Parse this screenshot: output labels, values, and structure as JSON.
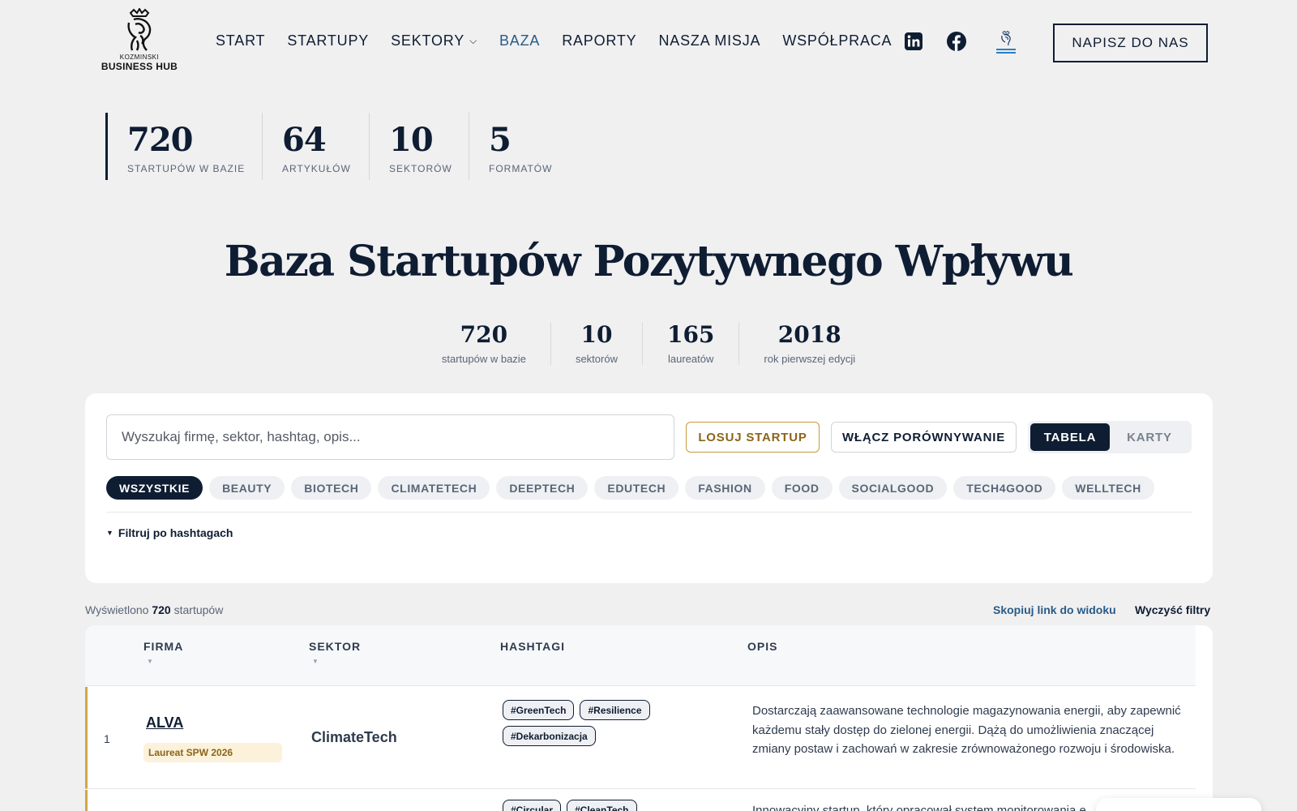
{
  "logo": {
    "small": "KOZMINSKI",
    "big": "BUSINESS HUB"
  },
  "nav": [
    {
      "label": "START"
    },
    {
      "label": "STARTUPY"
    },
    {
      "label": "SEKTORY"
    },
    {
      "label": "BAZA"
    },
    {
      "label": "RAPORTY"
    },
    {
      "label": "NASZA MISJA"
    },
    {
      "label": "WSPÓŁPRACA"
    }
  ],
  "social": {
    "linkedin": "linkedin-icon",
    "facebook": "facebook-icon",
    "kbh": "kozminski-business-hub-icon"
  },
  "cta_label": "NAPISZ DO NAS",
  "top_stats": [
    {
      "num": "720",
      "label": "STARTUPÓW W BAZIE"
    },
    {
      "num": "64",
      "label": "ARTYKUŁÓW"
    },
    {
      "num": "10",
      "label": "SEKTORÓW"
    },
    {
      "num": "5",
      "label": "FORMATÓW"
    }
  ],
  "title": "Baza Startupów Pozytywnego Wpływu",
  "mid_stats": [
    {
      "num": "720",
      "label": "startupów w bazie"
    },
    {
      "num": "10",
      "label": "sektorów"
    },
    {
      "num": "165",
      "label": "laureatów"
    },
    {
      "num": "2018",
      "label": "rok pierwszej edycji"
    }
  ],
  "search": {
    "placeholder": "Wyszukaj firmę, sektor, hashtag, opis..."
  },
  "buttons": {
    "losuj": "LOSUJ STARTUP",
    "porownywanie": "WŁĄCZ PORÓWNYWANIE"
  },
  "view_toggle": {
    "table": "TABELA",
    "cards": "KARTY",
    "selected": "TABELA"
  },
  "chips": [
    "WSZYSTKIE",
    "BEAUTY",
    "BIOTECH",
    "CLIMATETECH",
    "DEEPTECH",
    "EDUTECH",
    "FASHION",
    "FOOD",
    "SOCIALGOOD",
    "TECH4GOOD",
    "WELLTECH"
  ],
  "hashtag_filter": "Filtruj po hashtagach",
  "results": {
    "prefix": "Wyświetlono",
    "count": "720",
    "suffix": "startupów",
    "copy_link": "Skopiuj link do widoku",
    "clear": "Wyczyść filtry"
  },
  "table": {
    "headers": [
      "FIRMA",
      "SEKTOR",
      "HASHTAGI",
      "OPIS"
    ],
    "rows": [
      {
        "num": "1",
        "firm": "ALVA",
        "badge": "Laureat SPW 2026",
        "sector": "ClimateTech",
        "tags": [
          "#GreenTech",
          "#Resilience",
          "#Dekarbonizacja"
        ],
        "desc": "Dostarczają zaawansowane technologie magazynowania energii, aby zapewnić każdemu stały dostęp do zielonej energii. Dążą do umożliwienia znaczącej zmiany postaw i zachowań w zakresie zrównoważonego rozwoju i środowiska."
      },
      {
        "tags": [
          "#Circular",
          "#CleanTech"
        ],
        "desc": "Innowacyjny startup, który opracował system monitorowania e"
      }
    ]
  },
  "colors": {
    "navy": "#0f1d33",
    "gold": "#d4a645",
    "link": "#2a5b86",
    "bg": "#f0f0f1"
  }
}
